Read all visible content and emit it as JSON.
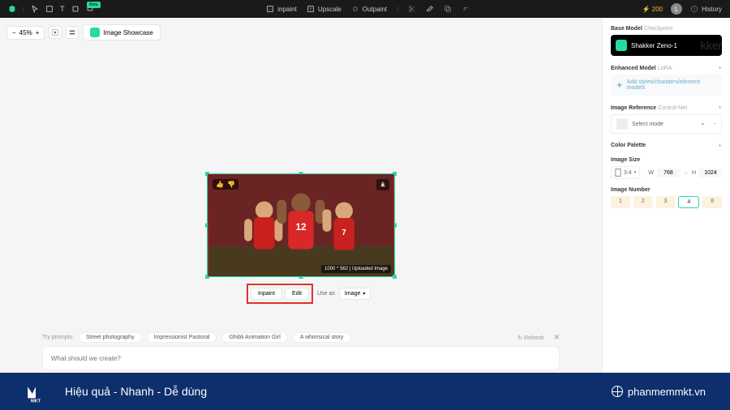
{
  "topbar": {
    "inpaint": "inpaint",
    "upscale": "Upscale",
    "outpaint": "Outpaint",
    "beta": "Beta",
    "credits": "200",
    "history": "History",
    "avatar": "L"
  },
  "toolbar": {
    "zoom": "45%",
    "showcase": "Image Showcase"
  },
  "image": {
    "meta": "1000 * 562 | Uploaded Image"
  },
  "actions": {
    "inpaint": "Inpaint",
    "edit": "Edit",
    "use_as": "Use as",
    "image": "Image"
  },
  "prompt": {
    "label": "Try prompts:",
    "chips": [
      "Street photography",
      "Impressionist Pastoral",
      "Ghibli Animation Girl",
      "A whimsical story"
    ],
    "refresh": "Refresh",
    "placeholder": "What should we create?"
  },
  "sidebar": {
    "base_model": {
      "label": "Base Model",
      "sublabel": "Checkpoint",
      "name": "Shakker Zeno-1"
    },
    "enhanced": {
      "label": "Enhanced Model",
      "sublabel": "LoRA",
      "add": "Add styles/charaters/element models"
    },
    "reference": {
      "label": "Image Reference",
      "sublabel": "Control-Net",
      "select": "Select mode"
    },
    "palette": {
      "label": "Color Palette"
    },
    "size": {
      "label": "Image Size",
      "ratio": "3:4",
      "w_label": "W",
      "w": "768",
      "h_label": "H",
      "h": "1024"
    },
    "number": {
      "label": "Image Number",
      "options": [
        "1",
        "2",
        "3",
        "4",
        "8"
      ],
      "selected": "4"
    }
  },
  "footer": {
    "brand": "MKT",
    "slogan": "Hiệu quả - Nhanh - Dễ dùng",
    "url": "phanmemmkt.vn"
  }
}
